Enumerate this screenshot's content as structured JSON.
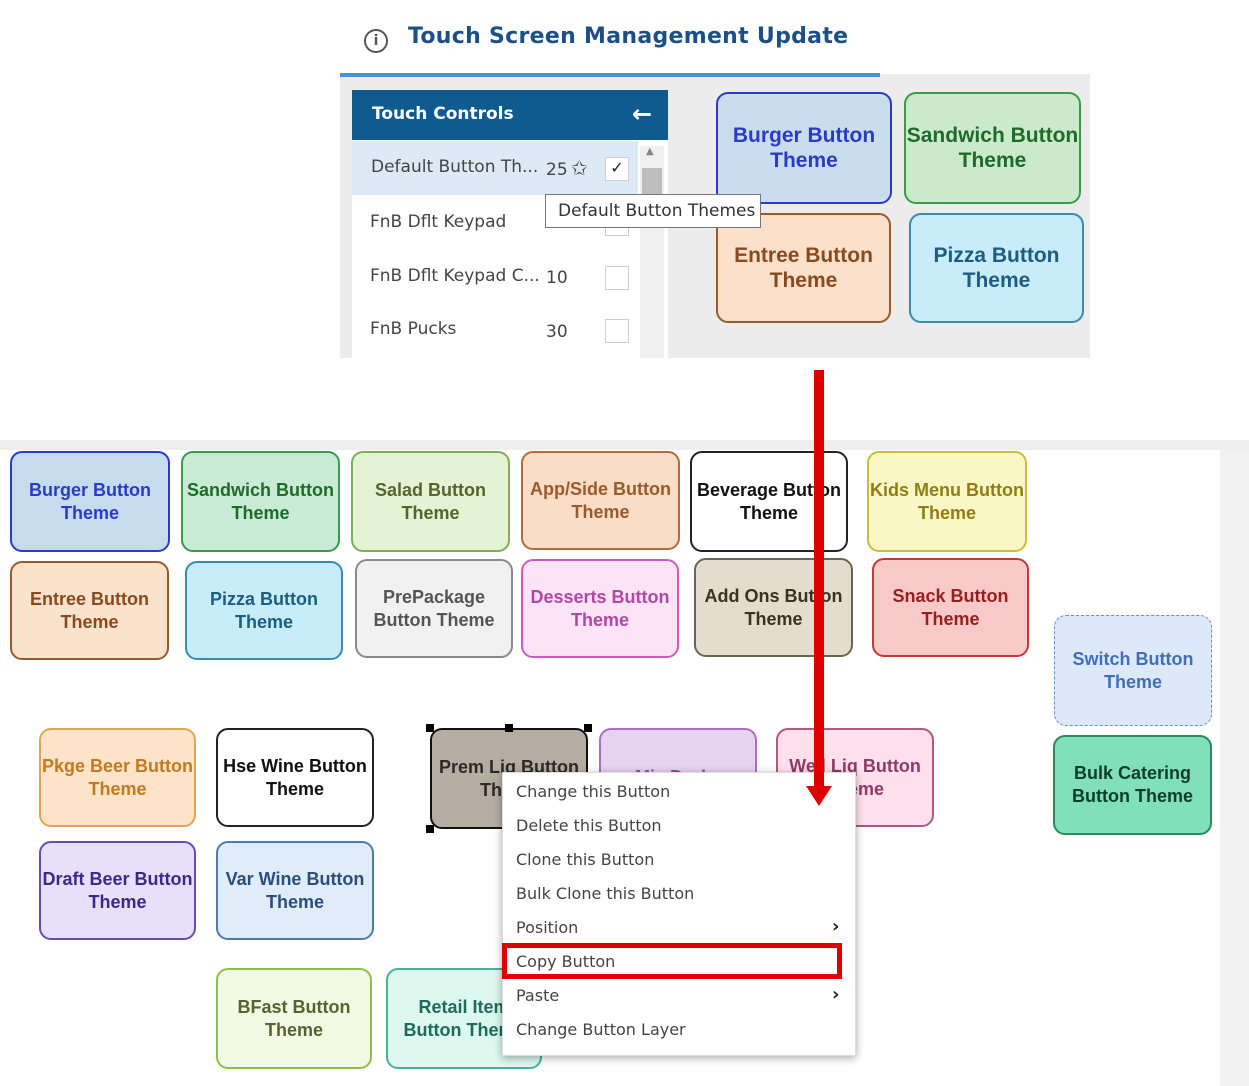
{
  "header": {
    "title": "Touch Screen Management Update",
    "info_icon": "info-icon"
  },
  "touch_controls": {
    "title": "Touch Controls",
    "back_icon": "arrow-left-icon",
    "rows": [
      {
        "name": "Default Button Th...",
        "count": "25",
        "checked": true
      },
      {
        "name": "FnB Dflt Keypad",
        "count": "",
        "checked": false
      },
      {
        "name": "FnB Dflt Keypad C...",
        "count": "10",
        "checked": false
      },
      {
        "name": "FnB Pucks",
        "count": "30",
        "checked": false
      }
    ],
    "tooltip": "Default Button Themes"
  },
  "top_buttons": [
    "Burger Button Theme",
    "Sandwich Button Theme",
    "Entree Button Theme",
    "Pizza Button Theme"
  ],
  "bottom_buttons": {
    "burger": "Burger Button Theme",
    "sandwich": "Sandwich Button Theme",
    "salad": "Salad Button Theme",
    "appside": "App/Side Button Theme",
    "beverage": "Beverage Button Theme",
    "kids": "Kids Menu Button Theme",
    "entree": "Entree Button Theme",
    "pizza": "Pizza Button Theme",
    "prepackage": "PrePackage Button Theme",
    "desserts": "Desserts Button Theme",
    "addons": "Add Ons Button Theme",
    "snack": "Snack Button Theme",
    "switch": "Switch Button Theme",
    "pkgebeer": "Pkge Beer Button Theme",
    "hsewine": "Hse Wine Button Theme",
    "premliq": "Prem Liq Button Theme",
    "mixdrnks": "Mix Drnks",
    "welliq": "Well Liq Button Theme",
    "bulkcatering": "Bulk Catering Button Theme",
    "draftbeer": "Draft Beer Button Theme",
    "varwine": "Var Wine Button Theme",
    "bfast": "BFast Button Theme",
    "retail": "Retail Item Button Theme"
  },
  "context_menu": {
    "items": [
      "Change this Button",
      "Delete this Button",
      "Clone this Button",
      "Bulk Clone this Button",
      "Position",
      "Copy Button",
      "Paste",
      "Change Button Layer"
    ],
    "submenu_icon": "chevron-right-icon"
  },
  "colors": {
    "highlight": "#e00000",
    "header_blue": "#0f5a8f"
  }
}
